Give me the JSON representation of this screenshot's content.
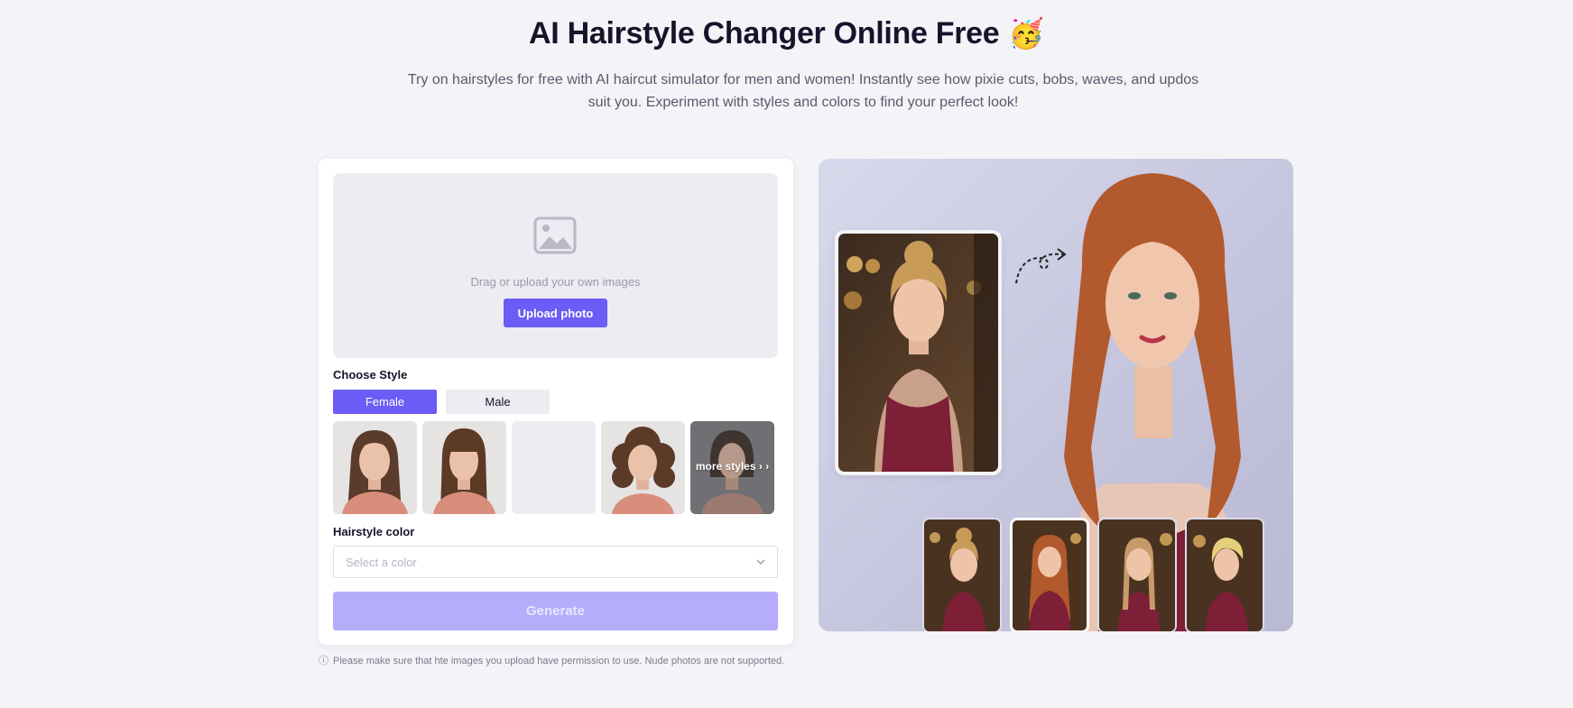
{
  "hero": {
    "title": "AI Hairstyle Changer Online Free",
    "emoji": "🥳",
    "subtitle": "Try on hairstyles for free with AI haircut simulator for men and women! Instantly see how pixie cuts, bobs, waves, and updos suit you. Experiment with styles and colors to find your perfect look!"
  },
  "upload": {
    "hint": "Drag or upload your own images",
    "button_label": "Upload photo"
  },
  "style": {
    "label": "Choose Style",
    "female_label": "Female",
    "male_label": "Male",
    "selected_gender": "Female",
    "thumbnails": [
      {
        "icon": "long-wavy-hair-thumbnail"
      },
      {
        "icon": "bangs-straight-hair-thumbnail"
      },
      {
        "icon": "empty-thumbnail"
      },
      {
        "icon": "curly-bob-thumbnail"
      },
      {
        "icon": "bob-thumbnail"
      }
    ],
    "more_label": "more styles › ›"
  },
  "color": {
    "label": "Hairstyle color",
    "placeholder": "Select a color"
  },
  "generate_label": "Generate",
  "disclaimer": "Please make sure that hte images you upload have permission to use. Nude photos are not supported.",
  "colors": {
    "accent": "#6a5cf4",
    "accent_disabled": "#b5acfa",
    "background": "#f3f3f8"
  }
}
